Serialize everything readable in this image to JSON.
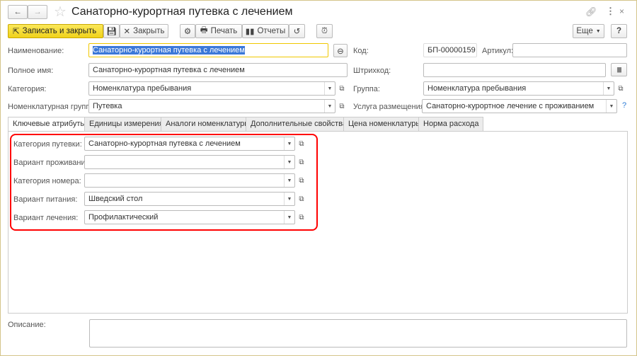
{
  "title": "Санаторно-курортная путевка с лечением",
  "toolbar": {
    "save_close": "Записать и закрыть",
    "close": "Закрыть",
    "print": "Печать",
    "reports": "Отчеты",
    "more": "Еще",
    "help": "?"
  },
  "fields": {
    "name": {
      "label": "Наименование:",
      "value": "Санаторно-курортная путевка с лечением"
    },
    "full_name": {
      "label": "Полное имя:",
      "value": "Санаторно-курортная путевка с лечением"
    },
    "category": {
      "label": "Категория:",
      "value": "Номенклатура пребывания"
    },
    "nom_group": {
      "label": "Номенклатурная группа:",
      "value": "Путевка"
    },
    "code": {
      "label": "Код:",
      "value": "БП-00000159"
    },
    "article": {
      "label": "Артикул:",
      "value": ""
    },
    "barcode": {
      "label": "Штрихкод:",
      "value": ""
    },
    "group": {
      "label": "Группа:",
      "value": "Номенклатура пребывания"
    },
    "service": {
      "label": "Услуга размещения:",
      "value": "Санаторно-курортное лечение с проживанием",
      "help": "?"
    }
  },
  "tabs": [
    {
      "label": "Ключевые атрибуты",
      "active": true
    },
    {
      "label": "Единицы измерения"
    },
    {
      "label": "Аналоги номенклатуры"
    },
    {
      "label": "Дополнительные свойства"
    },
    {
      "label": "Цена номенклатуры"
    },
    {
      "label": "Норма расхода"
    }
  ],
  "attributes": [
    {
      "label": "Категория путевки:",
      "value": "Санаторно-курортная путевка с лечением"
    },
    {
      "label": "Вариант проживания:",
      "value": ""
    },
    {
      "label": "Категория номера:",
      "value": ""
    },
    {
      "label": "Вариант питания:",
      "value": "Шведский стол"
    },
    {
      "label": "Вариант лечения:",
      "value": "Профилактический"
    }
  ],
  "description": {
    "label": "Описание:",
    "value": ""
  },
  "colors": {
    "highlight": "#ff0000",
    "accent": "#f0d21a"
  }
}
